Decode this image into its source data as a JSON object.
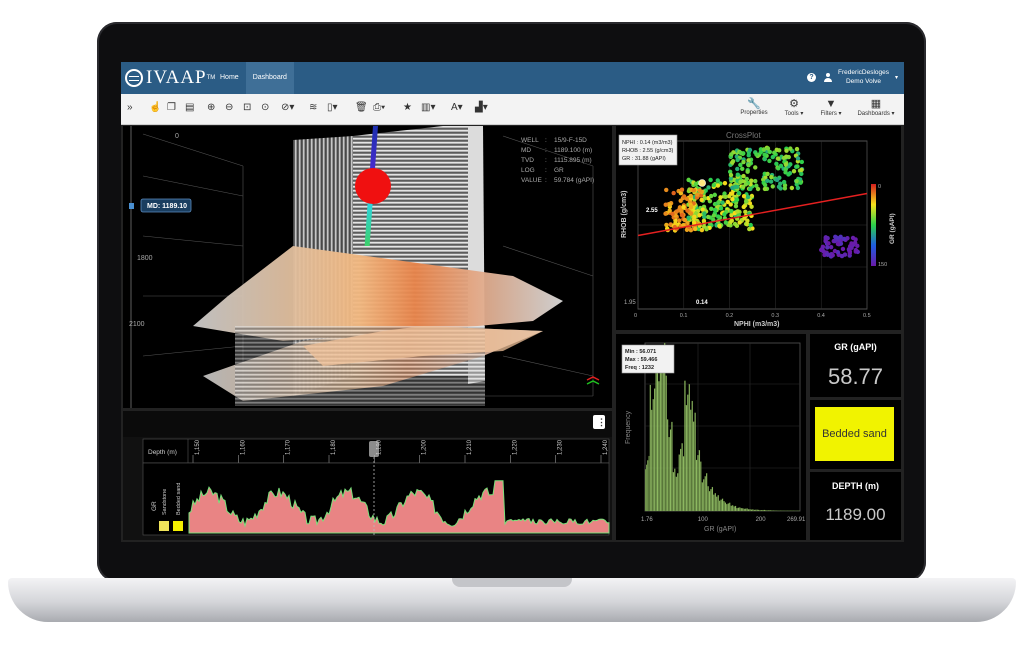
{
  "app": {
    "name": "IVAAP",
    "tm": "TM"
  },
  "nav": {
    "home": "Home",
    "dashboard": "Dashboard"
  },
  "user": {
    "help": "?",
    "name": "FredericDesloges",
    "project": "Demo Volve",
    "caret": "▾"
  },
  "toolbar": {
    "collapse": "»",
    "properties": "Properties",
    "tools": "Tools",
    "filters": "Filters",
    "dashboards": "Dashboards"
  },
  "view3d": {
    "info_keys": [
      "WELL",
      "MD",
      "TVD",
      "LOG",
      "VALUE"
    ],
    "info_values": [
      "15/9-F-15D",
      "1189.100 (m)",
      "1115.895 (m)",
      "GR",
      "59.784 (gAPI)"
    ],
    "md_label": "MD: 1189.10",
    "depth_ticks": [
      "0",
      "1800",
      "2100"
    ]
  },
  "crossplot": {
    "title": "CrossPlot",
    "tooltip": [
      "NPHI : 0.14 (m3/m3)",
      "RHOB : 2.55 (g/cm3)",
      "GR : 31.88 (gAPI)"
    ],
    "ylabel": "RHOB (g/cm3)",
    "xlabel": "NPHI (m3/m3)",
    "colorbar_label": "GR (gAPI)",
    "colorbar_ticks": [
      "0",
      "150"
    ],
    "marker_x": "0.14",
    "marker_y": "2.55"
  },
  "histogram": {
    "tooltip": [
      "Min : 56.071",
      "Max : 59.466",
      "Freq : 1232"
    ],
    "ylabel": "Frequency",
    "xlabel": "GR (gAPI)"
  },
  "kpis": {
    "gr_label": "GR (gAPI)",
    "gr_value": "58.77",
    "lithology": "Bedded sand",
    "depth_label": "DEPTH (m)",
    "depth_value": "1189.00"
  },
  "logtrack": {
    "menu": "⋮",
    "depth_header": "Depth (m)",
    "depth_ticks": [
      "1,150",
      "1,160",
      "1,170",
      "1,180",
      "1,190",
      "1,200",
      "1,210",
      "1,220",
      "1,230",
      "1,240"
    ],
    "track_label": "GR",
    "legend": [
      "Sandstone",
      "Bedded sand"
    ]
  },
  "chart_data": [
    {
      "type": "scatter",
      "title": "CrossPlot",
      "xlabel": "NPHI (m3/m3)",
      "ylabel": "RHOB (g/cm3)",
      "xlim": [
        0,
        0.5
      ],
      "x_ticks": [
        0,
        0.1,
        0.2,
        0.3,
        0.4,
        0.5
      ],
      "y_ticks": [
        "2.55",
        "1.95"
      ],
      "colorbar": {
        "label": "GR (gAPI)",
        "range": [
          0,
          150
        ]
      },
      "clusters": [
        {
          "nphi": 0.18,
          "rhob": 2.45,
          "gr": 60
        },
        {
          "nphi": 0.28,
          "rhob": 2.62,
          "gr": 70
        },
        {
          "nphi": 0.1,
          "rhob": 2.42,
          "gr": 25
        },
        {
          "nphi": 0.44,
          "rhob": 2.25,
          "gr": 145
        }
      ],
      "regression_line": [
        [
          0,
          2.3
        ],
        [
          0.5,
          2.5
        ]
      ],
      "highlight": {
        "nphi": 0.14,
        "rhob": 2.55,
        "gr": 31.88
      }
    },
    {
      "type": "bar",
      "xlabel": "GR (gAPI)",
      "ylabel": "Frequency",
      "x_ticks": [
        "1.76",
        "100",
        "200",
        "269.91"
      ],
      "xlim": [
        1.76,
        269.91
      ],
      "bins": [
        1.76,
        10,
        20,
        30,
        40,
        50,
        60,
        70,
        80,
        90,
        100,
        110,
        120,
        130,
        140,
        150,
        160,
        170,
        180,
        190,
        200,
        210,
        220,
        230,
        240,
        250,
        260
      ],
      "values": [
        380,
        920,
        1180,
        1232,
        650,
        300,
        480,
        900,
        760,
        420,
        260,
        180,
        130,
        90,
        60,
        40,
        25,
        18,
        12,
        9,
        7,
        5,
        4,
        3,
        2,
        2,
        1
      ]
    }
  ]
}
